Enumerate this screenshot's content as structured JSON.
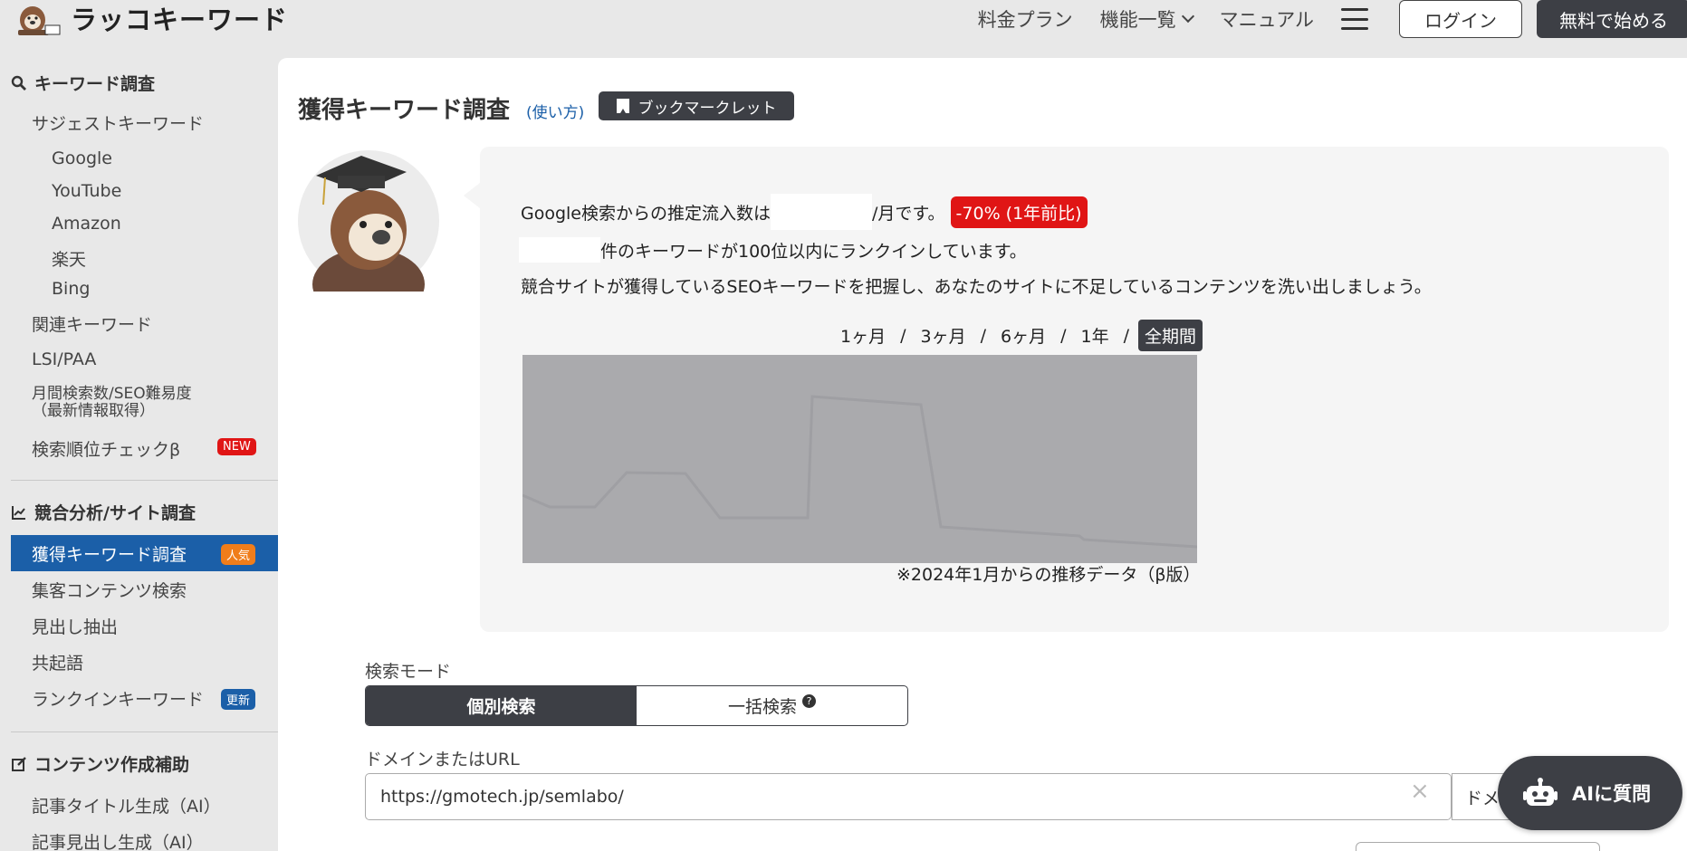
{
  "header": {
    "brand": "ラッコキーワード",
    "nav": [
      "料金プラン",
      "機能一覧",
      "マニュアル"
    ],
    "login": "ログイン",
    "signup": "無料で始める"
  },
  "sidebar": {
    "section_keyword": "キーワード調査",
    "suggest": "サジェストキーワード",
    "suggest_sub": [
      "Google",
      "YouTube",
      "Amazon",
      "楽天",
      "Bing"
    ],
    "related": "関連キーワード",
    "lsi": "LSI/PAA",
    "monthly_1": "月間検索数/SEO難易度",
    "monthly_2": "（最新情報取得）",
    "rank_check": "検索順位チェックβ",
    "badge_new": "NEW",
    "section_competitor": "競合分析/サイト調査",
    "acquired": "獲得キーワード調査",
    "badge_popular": "人気",
    "content_search": "集客コンテンツ検索",
    "heading_extract": "見出し抽出",
    "cooccur": "共起語",
    "rankin": "ランクインキーワード",
    "badge_update": "更新",
    "section_content": "コンテンツ作成補助",
    "title_gen": "記事タイトル生成（AI）",
    "heading_gen": "記事見出し生成（AI）"
  },
  "main": {
    "title": "獲得キーワード調査",
    "howto": "(使い方)",
    "bookmarklet": "ブックマークレット",
    "line1_prefix": "Google検索からの推定流入数は",
    "line1_suffix": "/月です。",
    "change_badge": "-70% (1年前比)",
    "line2_suffix": "件のキーワードが100位以内にランクインしています。",
    "line3": "競合サイトが獲得しているSEOキーワードを把握し、あなたのサイトに不足しているコンテンツを洗い出しましょう。",
    "periods": [
      "1ヶ月",
      "3ヶ月",
      "6ヶ月",
      "1年",
      "全期間"
    ],
    "chart_note": "※2024年1月からの推移データ（β版）",
    "mode_label": "検索モード",
    "mode_single": "個別検索",
    "mode_bulk": "一括検索",
    "url_label": "ドメインまたはURL",
    "url_value": "https://gmotech.jp/semlabo/",
    "domain_btn": "ドメ",
    "ai_button": "AIに質問"
  },
  "colors": {
    "accent_blue": "#1b5fa8",
    "dark": "#3d3f45",
    "badge_red": "#e01515",
    "badge_orange": "#f07d1a"
  }
}
